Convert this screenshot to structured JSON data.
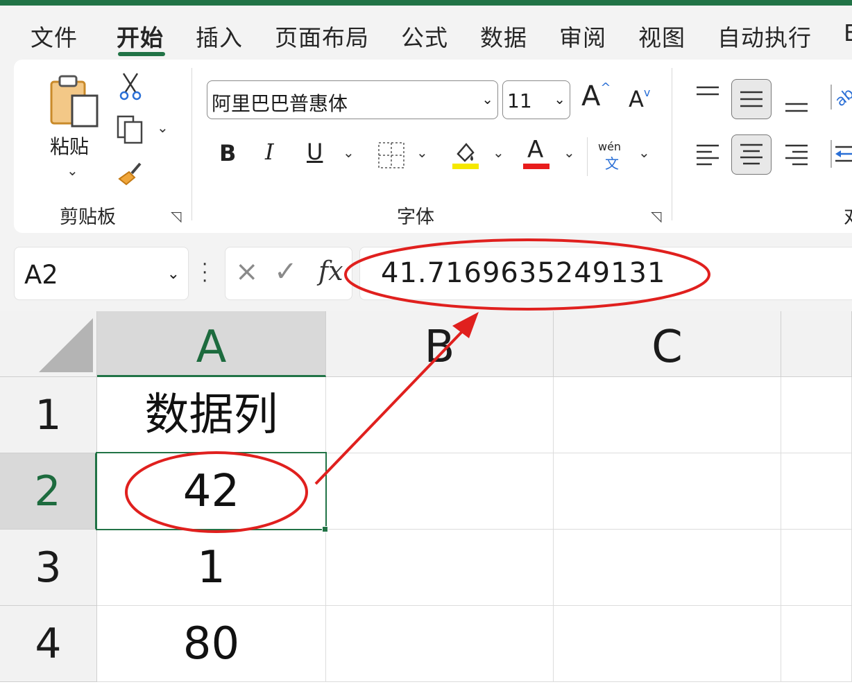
{
  "colors": {
    "accent_green": "#217346",
    "annotation_red": "#e0201e",
    "highlight_yellow": "#f5e800",
    "font_red": "#e81c1c"
  },
  "menu": {
    "tabs": [
      {
        "label": "文件"
      },
      {
        "label": "开始"
      },
      {
        "label": "插入"
      },
      {
        "label": "页面布局"
      },
      {
        "label": "公式"
      },
      {
        "label": "数据"
      },
      {
        "label": "审阅"
      },
      {
        "label": "视图"
      },
      {
        "label": "自动执行"
      },
      {
        "label": "E"
      }
    ],
    "active_tab": "开始"
  },
  "ribbon": {
    "clipboard": {
      "paste_label": "粘贴",
      "group_label": "剪贴板",
      "icons": [
        "paste-icon",
        "cut-icon",
        "copy-icon",
        "format-painter-icon"
      ]
    },
    "font": {
      "font_name": "阿里巴巴普惠体",
      "font_size": "11",
      "grow_label": "A",
      "shrink_label": "A",
      "bold_label": "B",
      "italic_label": "I",
      "underline_label": "U",
      "font_color_label": "A",
      "phonetic_top": "wén",
      "phonetic_bottom": "文",
      "group_label": "字体",
      "icons": [
        "border-icon",
        "fill-color-icon",
        "font-color-icon",
        "phonetic-guide-icon"
      ]
    },
    "alignment": {
      "icons": [
        "align-top-icon",
        "align-middle-icon",
        "align-bottom-icon",
        "orientation-icon",
        "align-left-icon",
        "align-center-icon",
        "align-right-icon",
        "decrease-indent-icon"
      ],
      "group_label_partial": "对"
    }
  },
  "formula_bar": {
    "name_box": "A2",
    "cancel_icon": "×",
    "enter_icon": "✓",
    "fx_label": "fx",
    "value": "41.7169635249131"
  },
  "sheet": {
    "columns": [
      "A",
      "B",
      "C"
    ],
    "selected_column": "A",
    "rows": [
      {
        "header": "1",
        "cells": [
          "数据列",
          "",
          ""
        ]
      },
      {
        "header": "2",
        "cells": [
          "42",
          "",
          ""
        ]
      },
      {
        "header": "3",
        "cells": [
          "1",
          "",
          ""
        ]
      },
      {
        "header": "4",
        "cells": [
          "80",
          "",
          ""
        ]
      }
    ],
    "selected_row": "2",
    "selected_cell": "A2"
  },
  "annotations": {
    "description_icons": [
      "circle-formula-value",
      "circle-cell-value",
      "arrow"
    ]
  }
}
